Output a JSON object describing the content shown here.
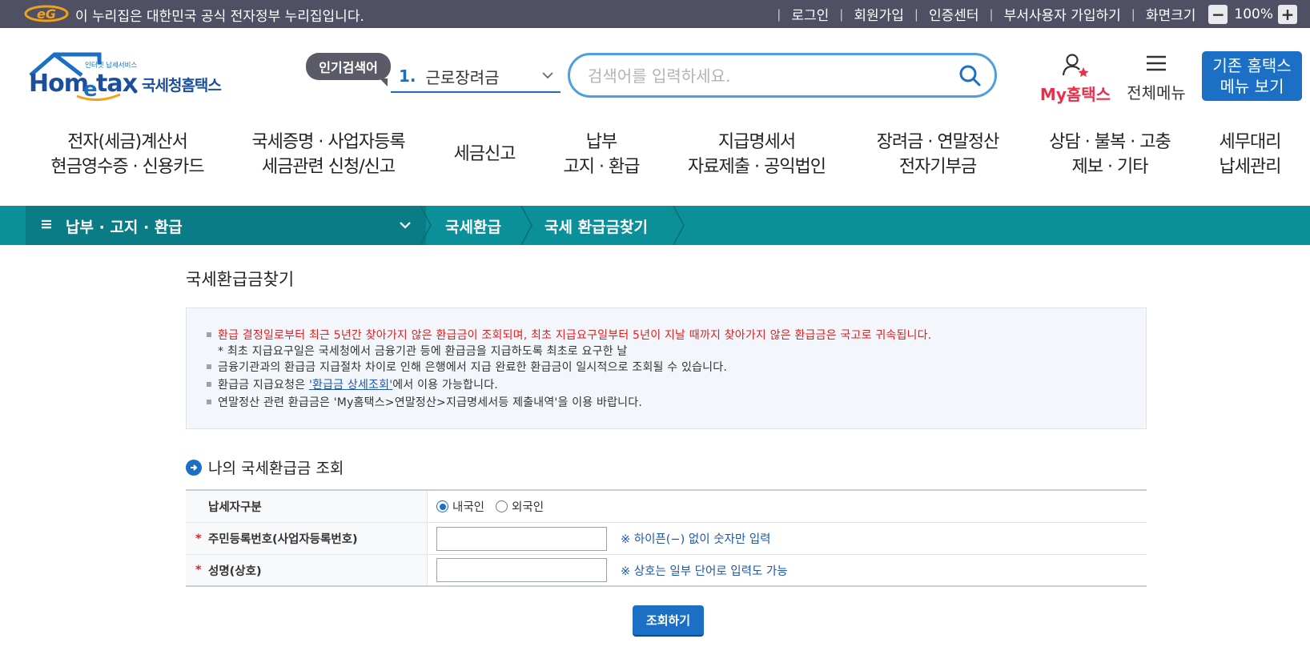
{
  "gov_bar": {
    "logo": "eg-logo",
    "text": "이 누리집은 대한민국 공식 전자정부 누리집입니다.",
    "links": [
      "로그인",
      "회원가입",
      "인증센터",
      "부서사용자 가입하기",
      "화면크기"
    ],
    "zoom_minus": "−",
    "zoom_value": "100%",
    "zoom_plus": "+"
  },
  "header": {
    "logo_small": "인터넷 납세서비스",
    "logo_main": "Hometax",
    "logo_sub": "국세청홈택스",
    "hot_badge": "인기검색어",
    "hot_num": "1.",
    "hot_word": "근로장려금",
    "search_placeholder": "검색어를 입력하세요.",
    "myhometax": "My홈택스",
    "allmenu": "전체메뉴",
    "legacy_line1": "기존 홈택스",
    "legacy_line2": "메뉴 보기"
  },
  "gnb": [
    {
      "line1": "전자(세금)계산서",
      "line2": "현금영수증 · 신용카드"
    },
    {
      "line1": "국세증명 · 사업자등록",
      "line2": "세금관련 신청/신고"
    },
    {
      "line1": "세금신고",
      "line2": ""
    },
    {
      "line1": "납부",
      "line2": "고지 · 환급"
    },
    {
      "line1": "지급명세서",
      "line2": "자료제출 · 공익법인"
    },
    {
      "line1": "장려금 · 연말정산",
      "line2": "전자기부금"
    },
    {
      "line1": "상담 · 불복 · 고충",
      "line2": "제보 · 기타"
    },
    {
      "line1": "세무대리",
      "line2": "납세관리"
    }
  ],
  "location": {
    "menu_icon": "≡",
    "section": "납부 · 고지 · 환급",
    "crumb1": "국세환급",
    "crumb2": "국세 환급금찾기"
  },
  "page": {
    "title": "국세환급금찾기",
    "notice": {
      "line1": "환급 결정일로부터 최근 5년간 찾아가지 않은 환급금이 조회되며, 최초 지급요구일부터 5년이 지날 때까지 찾아가지 않은 환급금은 국고로 귀속됩니다.",
      "line1_sub": "* 최초 지급요구일은 국세청에서 금융기관 등에 환급금을 지급하도록 최초로 요구한 날",
      "line2": "금융기관과의 환급금 지급절차 차이로 인해 은행에서 지급 완료한 환급금이 일시적으로 조회될 수 있습니다.",
      "line3_pre": "환급금 지급요청은 ",
      "line3_link": "'환급금 상세조회'",
      "line3_post": "에서 이용 가능합니다.",
      "line4": "연말정산 관련 환급금은 'My홈택스>연말정산>지급명세서등 제출내역'을 이용 바랍니다."
    },
    "section_title": "나의 국세환급금 조회",
    "form": {
      "row1_label": "납세자구분",
      "radio_domestic": "내국인",
      "radio_foreign": "외국인",
      "radio_selected": "내국인",
      "row2_label": "주민등록번호(사업자등록번호)",
      "row2_value": "",
      "row2_hint": "※ 하이픈(−) 없이 숫자만 입력",
      "row3_label": "성명(상호)",
      "row3_value": "",
      "row3_hint": "※ 상호는 일부 단어로 입력도 가능",
      "required_mark": "*"
    },
    "submit_label": "조회하기"
  },
  "colors": {
    "gov_bar": "#4f5064",
    "brand_blue": "#1b6fc4",
    "teal": "#0b8f98",
    "alert_red": "#e02020",
    "my_red": "#e8304b"
  }
}
